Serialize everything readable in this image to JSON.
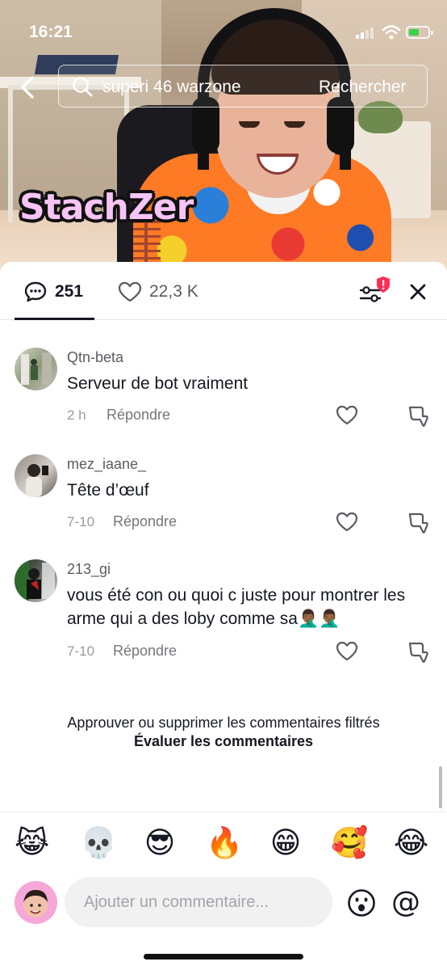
{
  "status_bar": {
    "time": "16:21"
  },
  "search": {
    "query": "superi 46 warzone",
    "button_label": "Rechercher"
  },
  "video": {
    "streamer_overlay": "StachZer"
  },
  "tabs": {
    "comment_count": "251",
    "like_count": "22,3 K"
  },
  "comments": [
    {
      "username": "Qtn-beta",
      "text": "Serveur de bot vraiment",
      "time": "2 h",
      "reply_label": "Répondre"
    },
    {
      "username": "mez_iaane_",
      "text": "Tête d’œuf",
      "time": "7-10",
      "reply_label": "Répondre"
    },
    {
      "username": "213_gi",
      "text": "vous été con ou quoi c juste pour montrer les arme qui a des loby comme sa🤦🏾‍♂️🤦🏾‍♂️",
      "time": "7-10",
      "reply_label": "Répondre"
    }
  ],
  "filtered": {
    "notice": "Approuver ou supprimer les commentaires filtrés",
    "action": "Évaluer les commentaires"
  },
  "emoji_bar": [
    "😹",
    "💀",
    "😎",
    "🔥",
    "😁",
    "🥰",
    "😂"
  ],
  "composer": {
    "placeholder": "Ajouter un commentaire..."
  },
  "icons": {
    "back": "chevron-left-icon",
    "search": "search-icon",
    "comments": "comment-bubble-icon",
    "likes": "heart-icon",
    "filter": "filter-sliders-icon",
    "close": "close-icon",
    "dislike": "thumbs-down-icon",
    "emoji": "emoji-face-icon",
    "mention": "at-sign-icon"
  },
  "colors": {
    "text": "#161823",
    "secondary": "#5a5b63",
    "badge": "#fe2c55",
    "input_bg": "#f1f1f2"
  }
}
